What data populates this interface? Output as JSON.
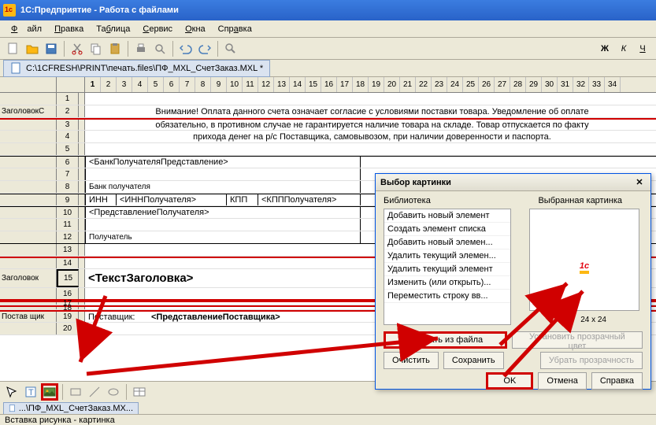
{
  "title": "1С:Предприятие  - Работа с файлами",
  "menu": [
    "Файл",
    "Правка",
    "Таблица",
    "Сервис",
    "Окна",
    "Справка"
  ],
  "doc_path": "С:\\1CFRESH\\PRINT\\печать.files\\ПФ_MXL_СчетЗаказ.MXL *",
  "ruler_cols": [
    "1",
    "2",
    "3",
    "4",
    "5",
    "6",
    "7",
    "8",
    "9",
    "10",
    "11",
    "12",
    "13",
    "14",
    "15",
    "16",
    "17",
    "18",
    "19",
    "20",
    "21",
    "22",
    "23",
    "24",
    "25",
    "26",
    "27",
    "28",
    "29",
    "30",
    "31",
    "32",
    "33",
    "34"
  ],
  "rows": {
    "header_label": "ЗаголовокС",
    "header_label2": "Заголовок",
    "supplier_label": "Постав щик",
    "nums": [
      "1",
      "2",
      "3",
      "4",
      "5",
      "6",
      "7",
      "8",
      "9",
      "10",
      "11",
      "12",
      "13",
      "14",
      "15",
      "16",
      "17",
      "18",
      "19",
      "20"
    ]
  },
  "warning_lines": [
    "Внимание! Оплата данного счета означает согласие с условиями поставки товара. Уведомление об оплате",
    "обязательно, в противном случае не гарантируется наличие товара на складе. Товар отпускается по факту",
    "прихода денег на р/с Поставщика, самовывозом, при наличии доверенности и паспорта."
  ],
  "cells": {
    "bank_repr": "<БанкПолучателяПредставление>",
    "bank_label": "Банк получателя",
    "inn": "ИНН",
    "inn_val": "<ИННПолучателя>",
    "kpp": "КПП",
    "kpp_val": "<КПППолучателя>",
    "recv_repr": "<ПредставлениеПолучателя>",
    "recv": "Получатель",
    "title_text": "<ТекстЗаголовка>",
    "supplier": "Поставщик:",
    "supplier_repr": "<ПредставлениеПоставщика>"
  },
  "dialog": {
    "title": "Выбор картинки",
    "lib_label": "Библиотека",
    "selected_label": "Выбранная картинка",
    "list": [
      "Добавить новый элемент",
      "Создать элемент списка",
      "Добавить новый элемен...",
      "Удалить текущий элемен...",
      "Удалить текущий элемент",
      "Изменить (или открыть)...",
      "Переместить строку вв..."
    ],
    "dims": "24 x 24",
    "btn_file": "Выбрать из файла",
    "btn_clear": "Очистить",
    "btn_save": "Сохранить",
    "btn_trans1": "Установить прозрачный цвет",
    "btn_trans2": "Убрать прозрачность",
    "btn_ok": "OK",
    "btn_cancel": "Отмена",
    "btn_help": "Справка"
  },
  "bottom_tab": "...\\ПФ_MXL_СчетЗаказ.MX...",
  "status": "Вставка рисунка - картинка"
}
